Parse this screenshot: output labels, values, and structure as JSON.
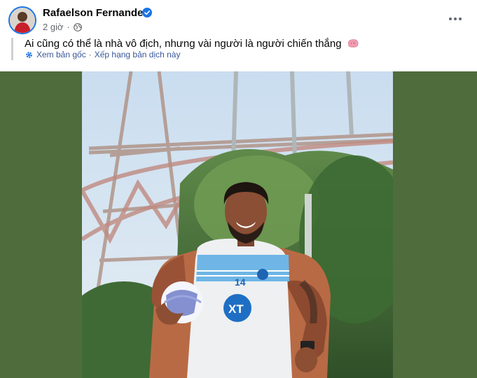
{
  "post": {
    "author_name": "Rafaelson Fernandes",
    "time": "2 giờ",
    "separator": "·",
    "caption": "Ai cũng có thể là nhà vô địch, nhưng vài người là người chiến thắng",
    "translate": {
      "see_original": "Xem bản gốc",
      "divider": "·",
      "rate_translation": "Xếp hạng bản dịch này"
    },
    "icons": {
      "verified": "verified-badge-icon",
      "privacy": "globe-icon",
      "more": "more-options-icon",
      "translate": "translate-settings-icon",
      "emoji": "brain-emoji-icon"
    },
    "photo": {
      "jersey_number": "14",
      "sponsor": "XT"
    },
    "colors": {
      "verified": "#1b74e4",
      "link": "#385898",
      "media_background": "#4f6c3c"
    }
  }
}
